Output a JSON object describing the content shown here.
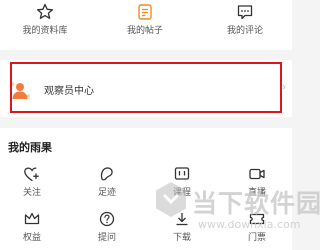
{
  "top_row": [
    {
      "label": "我的资料库",
      "icon": "star-icon"
    },
    {
      "label": "我的帖子",
      "icon": "post-document-icon"
    },
    {
      "label": "我的评论",
      "icon": "comment-icon"
    }
  ],
  "observer_center": {
    "label": "观察员中心",
    "icon": "observer-avatar-icon"
  },
  "highlight_color": "#e0141e",
  "yuguo": {
    "title": "我的雨果",
    "items": [
      {
        "label": "关注",
        "icon": "heart-plus-icon"
      },
      {
        "label": "足迹",
        "icon": "footprint-icon"
      },
      {
        "label": "课程",
        "icon": "course-icon"
      },
      {
        "label": "直播",
        "icon": "live-video-icon"
      },
      {
        "label": "权益",
        "icon": "crown-icon"
      },
      {
        "label": "提问",
        "icon": "question-icon"
      },
      {
        "label": "下载",
        "icon": "download-icon"
      },
      {
        "label": "门票",
        "icon": "ticket-icon"
      }
    ]
  },
  "watermark": {
    "brand": "当下软件园",
    "url": "www.downxia.com",
    "logo": "downxia-logo"
  }
}
